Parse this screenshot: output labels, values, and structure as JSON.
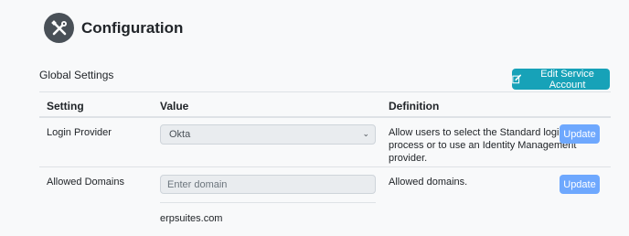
{
  "header": {
    "title": "Configuration",
    "icon": "tools-icon"
  },
  "global_settings": {
    "title": "Global Settings",
    "edit_service_account_label": "Edit Service Account",
    "columns": [
      "Setting",
      "Value",
      "Definition"
    ],
    "rows": [
      {
        "setting": "Login Provider",
        "value": "Okta",
        "definition_lines": [
          "Allow users to select the Standard login",
          "process or to use an Identity Management",
          "provider."
        ],
        "action": "Update"
      },
      {
        "setting": "Allowed Domains",
        "placeholder": "Enter domain",
        "domains": [
          "erpsuites.com"
        ],
        "definition_lines": [
          "Allowed domains."
        ],
        "action": "Update"
      }
    ]
  },
  "colors": {
    "accent": "#17a2b8",
    "update_button": "#6ea8fe",
    "logo_bg": "#495057"
  }
}
